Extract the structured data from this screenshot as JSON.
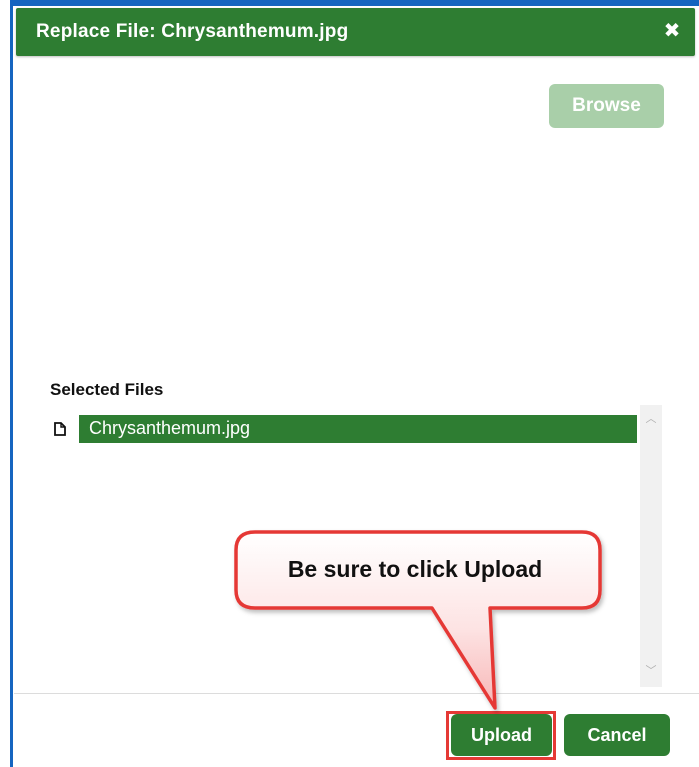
{
  "dialog": {
    "title": "Replace File: Chrysanthemum.jpg",
    "close_icon": "close-icon",
    "close_glyph": "✖"
  },
  "browse": {
    "label": "Browse",
    "state": "disabled"
  },
  "selected_files": {
    "heading": "Selected Files",
    "items": [
      {
        "name": "Chrysanthemum.jpg",
        "icon": "file-icon",
        "selected": true
      }
    ],
    "scroll_up_glyph": "︿",
    "scroll_down_glyph": "﹀"
  },
  "callout": {
    "text": "Be sure to click Upload"
  },
  "footer": {
    "upload_label": "Upload",
    "cancel_label": "Cancel"
  },
  "colors": {
    "primary_green": "#2e7d32",
    "disabled_green": "#a9cfa9",
    "highlight_red": "#e53935",
    "frame_blue": "#1565c0"
  }
}
